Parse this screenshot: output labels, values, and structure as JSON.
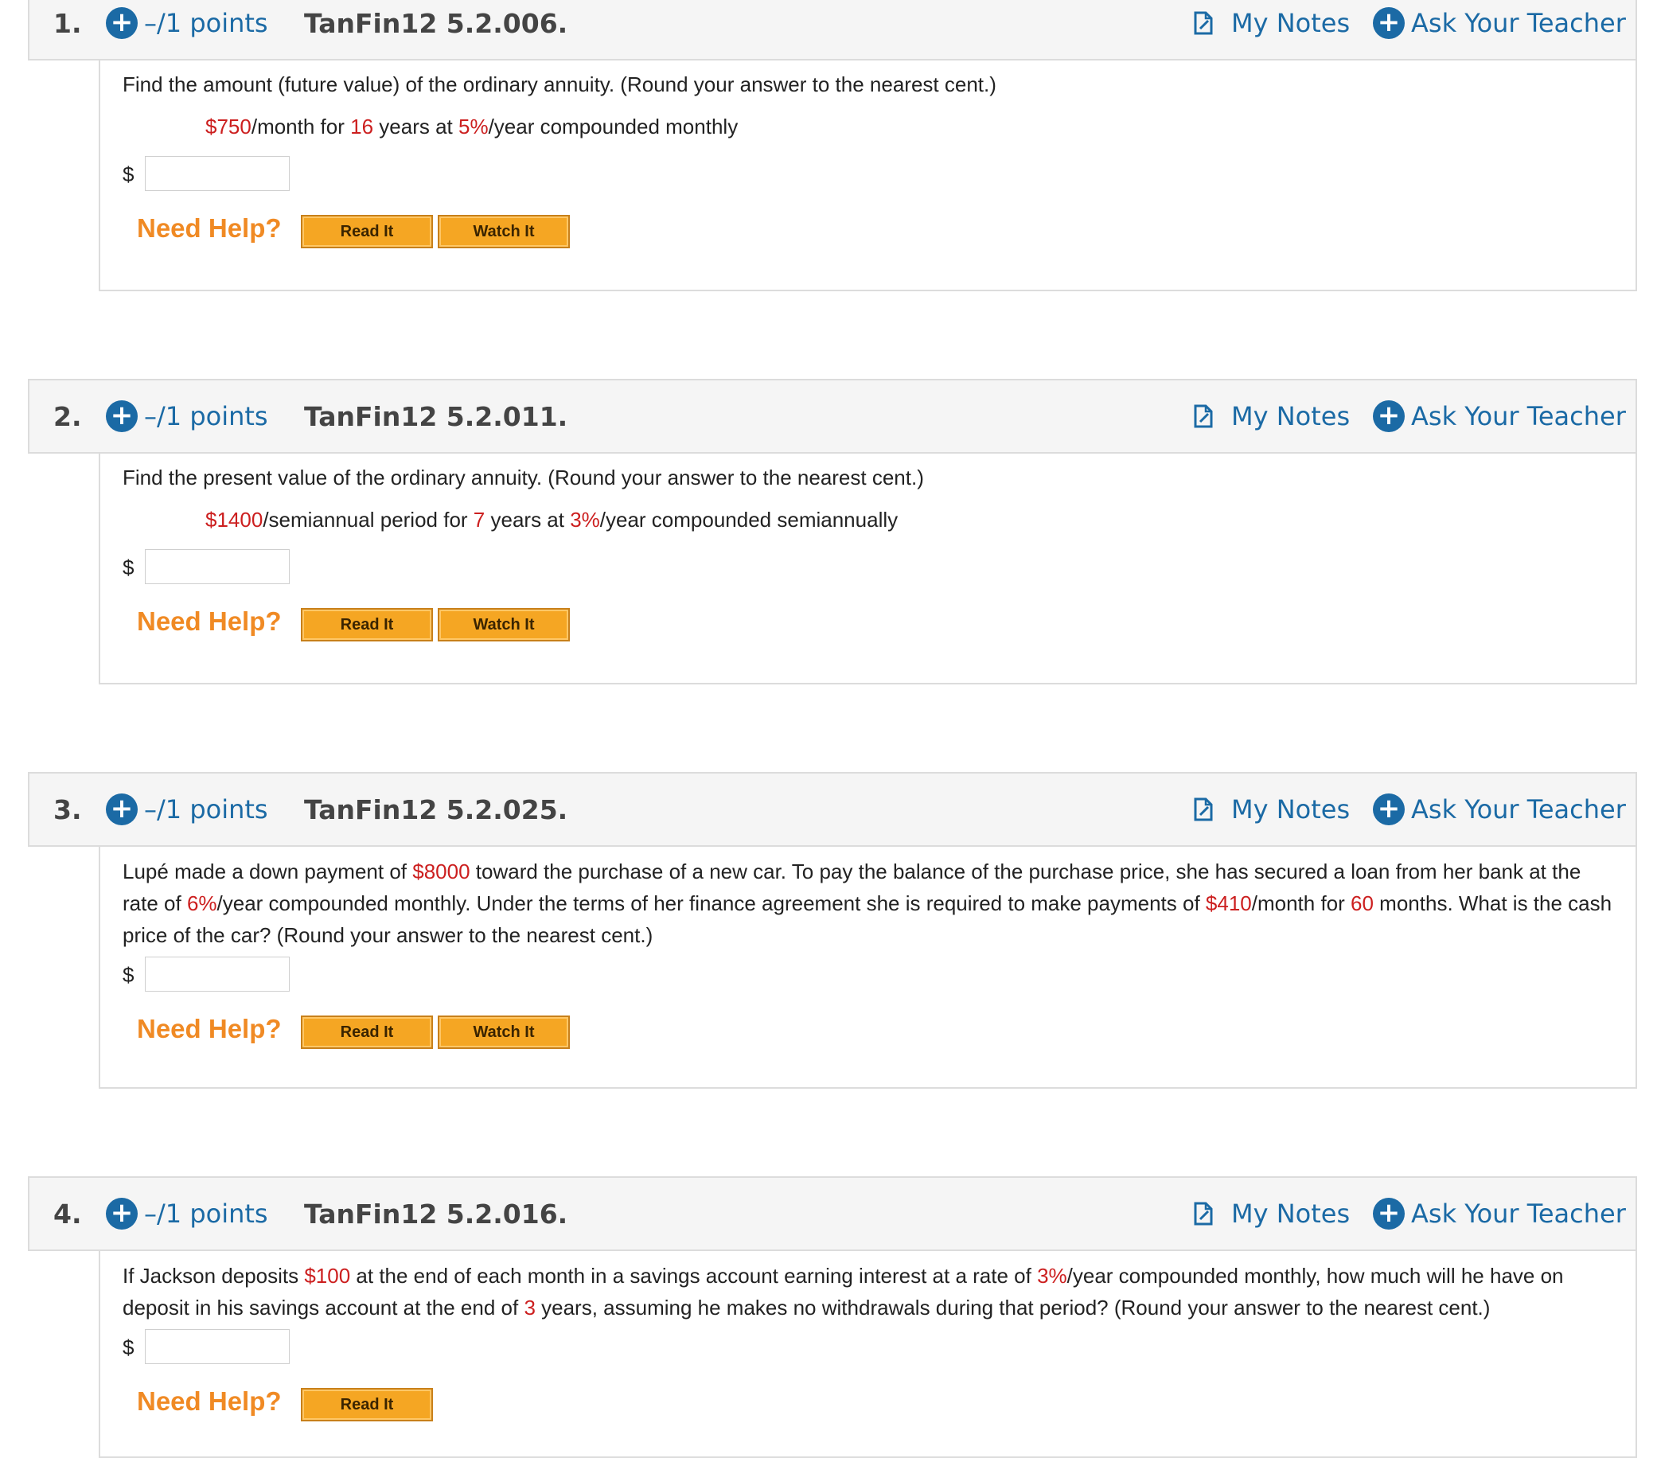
{
  "common": {
    "points": "–/1 points",
    "my_notes": "My Notes",
    "ask_teacher": "Ask Your Teacher",
    "need_help": "Need Help?",
    "read_it": "Read It",
    "watch_it": "Watch It",
    "currency": "$"
  },
  "questions": [
    {
      "number": "1.",
      "id": "TanFin12 5.2.006.",
      "prompt": "Find the amount (future value) of the ordinary annuity. (Round your answer to the nearest cent.)",
      "given": [
        {
          "t": "$750",
          "red": true
        },
        {
          "t": "/month for ",
          "red": false
        },
        {
          "t": "16",
          "red": true
        },
        {
          "t": " years at ",
          "red": false
        },
        {
          "t": "5%",
          "red": true
        },
        {
          "t": "/year compounded monthly",
          "red": false
        }
      ],
      "answer_value": "",
      "has_watch": true
    },
    {
      "number": "2.",
      "id": "TanFin12 5.2.011.",
      "prompt": "Find the present value of the ordinary annuity. (Round your answer to the nearest cent.)",
      "given": [
        {
          "t": "$1400",
          "red": true
        },
        {
          "t": "/semiannual period for ",
          "red": false
        },
        {
          "t": "7",
          "red": true
        },
        {
          "t": " years at ",
          "red": false
        },
        {
          "t": "3%",
          "red": true
        },
        {
          "t": "/year compounded semiannually",
          "red": false
        }
      ],
      "answer_value": "",
      "has_watch": true
    },
    {
      "number": "3.",
      "id": "TanFin12 5.2.025.",
      "prompt_parts": [
        {
          "t": "Lupé made a down payment of ",
          "red": false
        },
        {
          "t": "$8000",
          "red": true
        },
        {
          "t": " toward the purchase of a new car. To pay the balance of the purchase price, she has secured a loan from her bank at the rate of ",
          "red": false
        },
        {
          "t": "6%",
          "red": true
        },
        {
          "t": "/year compounded monthly. Under the terms of her finance agreement she is required to make payments of ",
          "red": false
        },
        {
          "t": "$410",
          "red": true
        },
        {
          "t": "/month for ",
          "red": false
        },
        {
          "t": "60",
          "red": true
        },
        {
          "t": " months. What is the cash price of the car? (Round your answer to the nearest cent.)",
          "red": false
        }
      ],
      "answer_value": "",
      "has_watch": true
    },
    {
      "number": "4.",
      "id": "TanFin12 5.2.016.",
      "prompt_parts": [
        {
          "t": "If Jackson deposits ",
          "red": false
        },
        {
          "t": "$100",
          "red": true
        },
        {
          "t": " at the end of each month in a savings account earning interest at a rate of ",
          "red": false
        },
        {
          "t": "3%",
          "red": true
        },
        {
          "t": "/year compounded monthly, how much will he have on deposit in his savings account at the end of ",
          "red": false
        },
        {
          "t": "3",
          "red": true
        },
        {
          "t": " years, assuming he makes no withdrawals during that period? (Round your answer to the nearest cent.)",
          "red": false
        }
      ],
      "answer_value": "",
      "has_watch": false
    }
  ],
  "colors": {
    "link_blue": "#1b6aa5",
    "value_red": "#cc1f1f",
    "help_orange": "#f08a24",
    "button_orange": "#f5a623",
    "header_bg": "#f5f5f5"
  },
  "icons": {
    "points": "plus-circle-icon",
    "notes": "notes-document-icon",
    "ask": "plus-circle-icon"
  }
}
